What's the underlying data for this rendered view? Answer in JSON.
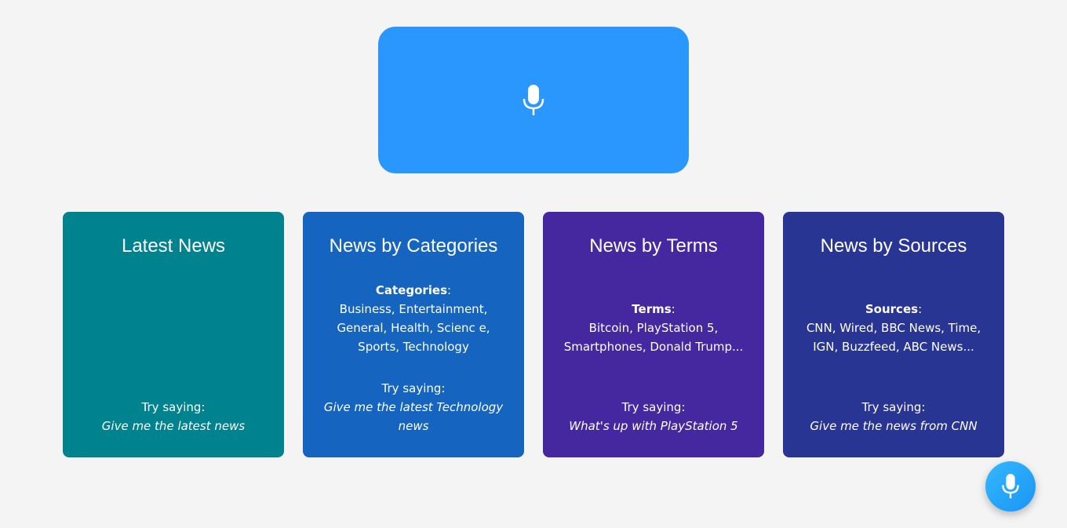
{
  "header": {
    "icon": "microphone-icon",
    "color": "#2a97ff"
  },
  "cards": [
    {
      "title": "Latest News",
      "color": "#00838f",
      "try_label": "Try saying:",
      "example": "Give me the latest news"
    },
    {
      "title": "News by Categories",
      "color": "#1565c0",
      "info_label": "Categories",
      "info_sep": ":",
      "info_text": "Business, Entertainment, General, Health, Scienc e, Sports, Technology",
      "try_label": "Try saying:",
      "example": "Give me the latest Technology news"
    },
    {
      "title": "News by Terms",
      "color": "#4527a0",
      "info_label": "Terms",
      "info_sep": ":",
      "info_text": "Bitcoin, PlayStation 5, Smartphones, Donald Trump...",
      "try_label": "Try saying:",
      "example": "What's up with PlayStation 5"
    },
    {
      "title": "News by Sources",
      "color": "#283593",
      "info_label": "Sources",
      "info_sep": ":",
      "info_text": "CNN, Wired, BBC News, Time, IGN, Buzzfeed, ABC News...",
      "try_label": "Try saying:",
      "example": "Give me the news from CNN"
    }
  ],
  "fab": {
    "icon": "microphone-icon"
  }
}
